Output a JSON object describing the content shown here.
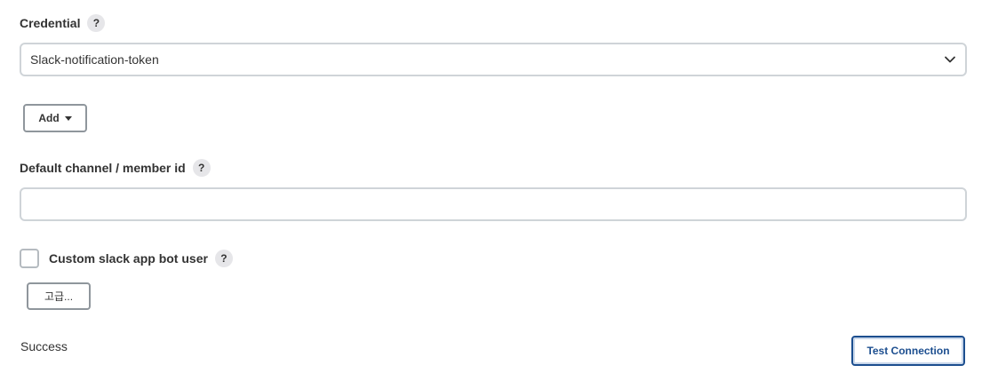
{
  "credential": {
    "label": "Credential",
    "help": "?",
    "selected": "Slack-notification-token",
    "chevron_icon": "chevron-down-icon"
  },
  "add_button": {
    "label": "Add"
  },
  "default_channel": {
    "label": "Default channel / member id",
    "help": "?",
    "value": ""
  },
  "custom_bot": {
    "label": "Custom slack app bot user",
    "help": "?",
    "checked": false
  },
  "advanced_button": {
    "label": "고급..."
  },
  "status": {
    "text": "Success"
  },
  "test_button": {
    "label": "Test Connection",
    "color": "#1c4e8f"
  }
}
